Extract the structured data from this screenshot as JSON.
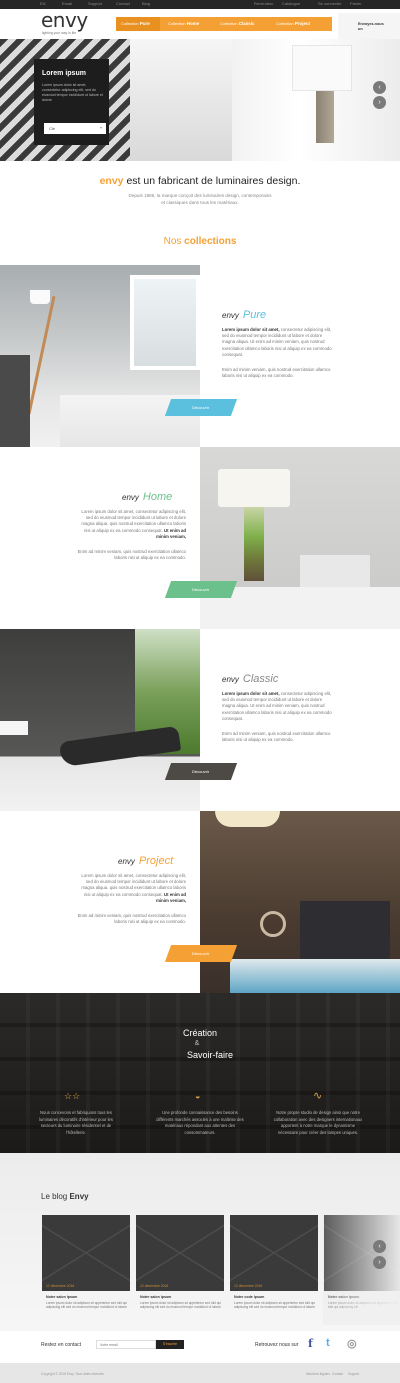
{
  "topbar": {
    "items": [
      "EN",
      "Email",
      "Support",
      "Contact",
      "Blog",
      "Revendeur",
      "Catalogue",
      "Se connecter",
      "Panier"
    ]
  },
  "brand": {
    "logo_text": "envy",
    "tagline": "lighting your way in life"
  },
  "nav": {
    "items": [
      {
        "prefix": "Collection",
        "label": "Pure"
      },
      {
        "prefix": "Collection",
        "label": "Home"
      },
      {
        "prefix": "Collection",
        "label": "Classic"
      },
      {
        "prefix": "Collection",
        "label": "Project"
      }
    ],
    "right_label": "Envoyez-nous un"
  },
  "hero": {
    "box_title": "Lorem ipsum",
    "box_text": "Lorem ipsum dolor sit amet, consectetur adipiscing elit, sed do eiusmod tempor incididunt ut labore et dolore",
    "select_value": "Clé",
    "arrow_up": "‹",
    "arrow_down": "›"
  },
  "intro": {
    "title_brand": "envy",
    "title_rest": " est un fabricant de luminaires design.",
    "text": "Depuis 1986, la marque conçoit des luminaires design, contemporains et classiques dans tous les matériaux."
  },
  "collections_title": {
    "part1": "Nos ",
    "part2": "collections"
  },
  "collections": [
    {
      "brand": "envy",
      "name": "Pure",
      "color": "#5bc0de",
      "p1_bold": "Lorem ipsum dolor sit amet,",
      "p1": " consectetur adipiscing elit, sed do eiusmod tempor incididunt ut labore et dolore magna aliqua. Ut enim ad minim veniam, quis nostrud exercitation ullamco laboris nisi ut aliquip ex ea commodo consequat.",
      "p2": "Enim ad minim veniam, quis nostrud exercitation ullamco laboris nisi ut aliquip ex ea commodo.",
      "button": "Découvrir"
    },
    {
      "brand": "envy",
      "name": "Home",
      "color": "#6cc08b",
      "p1_bold": "Ut enim ad minim veniam,",
      "p1": "Lorem ipsum dolor sit amet, consectetur adipiscing elit, sed do eiusmod tempor incididunt ut labore et dolore magna aliqua. quis nostrud exercitation ullamco laboris nisi ut aliquip ex ea commodo consequat.",
      "p2": "Enim ad minim veniam, quis nostrud exercitation ullamco laboris nisi ut aliquip ex ea commodo.",
      "button": "Découvrir"
    },
    {
      "brand": "envy",
      "name": "Classic",
      "color": "#4d4a45",
      "p1_bold": "Lorem ipsum dolor sit amet,",
      "p1": " consectetur adipiscing elit, sed do eiusmod tempor incididunt ut labore et dolore magna aliqua. Ut enim ad minim veniam, quis nostrud exercitation ullamco laboris nisi ut aliquip ex ea commodo consequat.",
      "p2": "Enim ad minim veniam, quis nostrud exercitation ullamco laboris nisi ut aliquip ex ea commodo.",
      "button": "Découvrir"
    },
    {
      "brand": "envy",
      "name": "Project",
      "color": "#f4a034",
      "p1_bold": "Ut enim ad minim veniam,",
      "p1": "Lorem ipsum dolor sit amet, consectetur adipiscing elit, sed do eiusmod tempor incididunt ut labore et dolore magna aliqua. quis nostrud exercitation ullamco laboris nisi ut aliquip ex ea commodo consequat.",
      "p2": "Enim ad minim veniam, quis nostrud exercitation ullamco laboris nisi ut aliquip ex ea commodo.",
      "button": "Découvrir"
    }
  ],
  "creation": {
    "title1": "Création",
    "amp": "&",
    "title2": "Savoir-faire",
    "items": [
      {
        "icon": "stars-icon",
        "glyph": "☆☆",
        "text": "Nous concevons et fabriquons tous les luminaires décoratifs d'intérieur pour les secteurs du luminaire résidentiel et de l'hôtellerie."
      },
      {
        "icon": "lamp-icon",
        "glyph": "◒",
        "text": "Une profonde connaissance des besoins différents marchés associés à une maîtrise des matériaux répondant aux attentes des consommateurs."
      },
      {
        "icon": "swirl-icon",
        "glyph": "∿",
        "text": "Notre propre studio de design ainsi que notre collaboration avec des designers internationaux apportent à notre marque le dynamisme nécessaire pour créer des lampes uniques."
      }
    ]
  },
  "blog": {
    "title_prefix": "Le blog ",
    "title_brand": "Envy",
    "cards": [
      {
        "date": "12 décembre 2016",
        "title": "Notre salon Ipsum",
        "text": "Lorem ipsum dolor sit adipiscin sit appetentur sed tulit qui adipiscing elit sed do eiusmod tempor incididunt ut labore"
      },
      {
        "date": "12 décembre 2016",
        "title": "Notre salon Ipsum",
        "text": "Lorem ipsum dolor sit adipiscin sit appetentur sed tulit qui adipiscing elit sed do eiusmod tempor incididunt ut labore"
      },
      {
        "date": "12 décembre 2016",
        "title": "Notre code Ipsum",
        "text": "Lorem ipsum dolor sit adipiscin sit appetentur sed tulit qui adipiscing elit sed do eiusmod tempor incididunt ut labore"
      },
      {
        "date": "",
        "title": "Notre salon Ipsum",
        "text": "Lorem ipsum dolor sit adipiscin sit appetentur sed tulit qui adipiscing elit"
      }
    ],
    "arrow_prev": "‹",
    "arrow_next": "›"
  },
  "newsletter": {
    "label": "Restez en contact",
    "placeholder": "Votre email",
    "button": "S'inscrire"
  },
  "social": {
    "label": "Retrouvez nous sur",
    "items": [
      {
        "icon": "facebook-icon",
        "glyph": "f",
        "color": "#3b5998"
      },
      {
        "icon": "twitter-icon",
        "glyph": "t",
        "color": "#55acee"
      },
      {
        "icon": "instagram-icon",
        "glyph": "◎",
        "color": "#999999"
      }
    ]
  },
  "footer": {
    "copyright": "Copyright © 2016 Envy. Tous droits réservés",
    "links": [
      "Mentions légales",
      "Contact",
      "Support"
    ]
  }
}
